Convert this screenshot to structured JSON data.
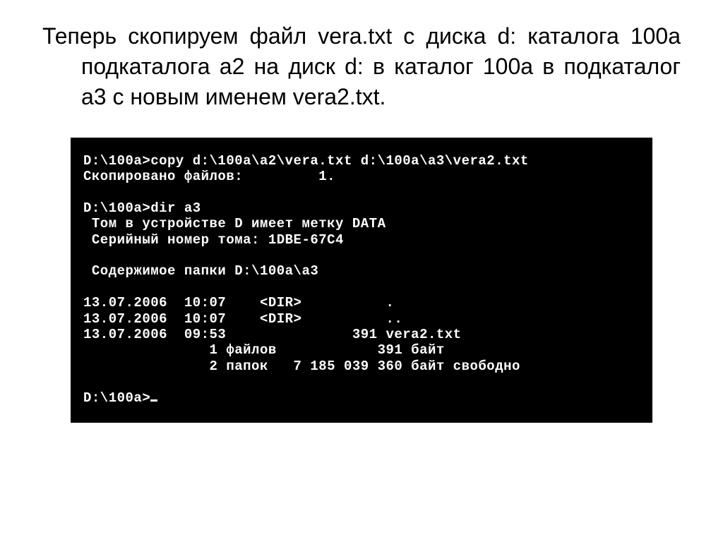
{
  "description": "Теперь скопируем файл vera.txt с диска d: каталога 100a подкаталога а2 на диск d: в каталог 100a в подкаталог а3 с новым именем vera2.txt.",
  "terminal": {
    "prompt1": "D:\\100a>",
    "cmd1": "copy d:\\100a\\a2\\vera.txt d:\\100a\\a3\\vera2.txt",
    "out1": "Скопировано файлов:         1.",
    "prompt2": "D:\\100a>",
    "cmd2": "dir a3",
    "vol_label": " Том в устройстве D имеет метку DATA",
    "vol_serial": " Серийный номер тома: 1DBE-67C4",
    "dir_header": " Содержимое папки D:\\100a\\a3",
    "row1": "13.07.2006  10:07    <DIR>          .",
    "row2": "13.07.2006  10:07    <DIR>          ..",
    "row3": "13.07.2006  09:53               391 vera2.txt",
    "summary_files": "               1 файлов            391 байт",
    "summary_dirs": "               2 папок   7 185 039 360 байт свободно",
    "prompt3": "D:\\100a>"
  }
}
